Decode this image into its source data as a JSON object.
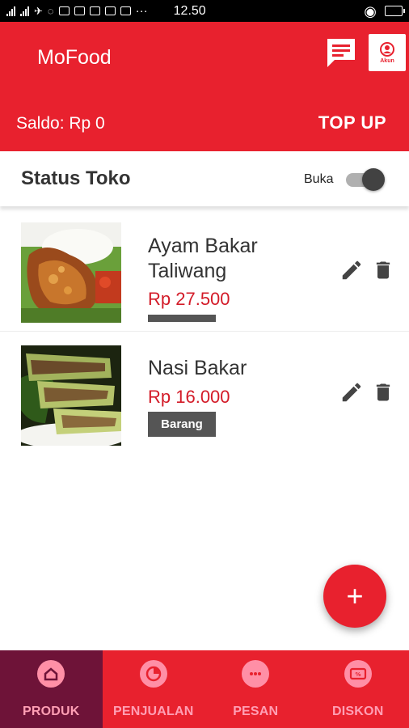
{
  "status_bar": {
    "time": "12.50",
    "dots": "···"
  },
  "app": {
    "title": "MoFood",
    "account_label": "Akun"
  },
  "balance": {
    "saldo_text": "Saldo: Rp 0",
    "topup_label": "TOP UP"
  },
  "store": {
    "title": "Status Toko",
    "state_label": "Buka",
    "is_open": true
  },
  "products": [
    {
      "name": "Ayam Bakar Taliwang",
      "price": "Rp 27.500",
      "badge": ""
    },
    {
      "name": "Nasi Bakar",
      "price": "Rp 16.000",
      "badge": "Barang"
    }
  ],
  "fab": {
    "label": "+"
  },
  "bottom_nav": [
    {
      "label": "PRODUK",
      "icon": "home-icon",
      "active": true
    },
    {
      "label": "PENJUALAN",
      "icon": "pie-chart-icon",
      "active": false
    },
    {
      "label": "PESAN",
      "icon": "chat-icon",
      "active": false
    },
    {
      "label": "DISKON",
      "icon": "coupon-icon",
      "active": false
    }
  ],
  "colors": {
    "primary": "#e8212e",
    "active_nav": "#6e1338",
    "nav_text": "#ff9fb4",
    "price": "#d31b28"
  }
}
